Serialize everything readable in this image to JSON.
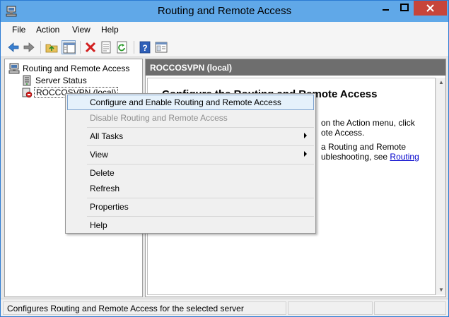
{
  "window": {
    "title": "Routing and Remote Access"
  },
  "menubar": {
    "items": [
      "File",
      "Action",
      "View",
      "Help"
    ]
  },
  "toolbar": {
    "icons": [
      "back-arrow-icon",
      "forward-arrow-icon",
      "up-folder-icon",
      "show-hide-tree-icon",
      "delete-icon",
      "properties-icon",
      "refresh-icon",
      "help-icon",
      "console-view-icon"
    ]
  },
  "tree": {
    "root": "Routing and Remote Access",
    "items": [
      "Server Status",
      "ROCCOSVPN (local)"
    ]
  },
  "rightpane": {
    "header": "ROCCOSVPN (local)",
    "heading": "Configure the Routing and Remote Access",
    "lines": [
      "on the Action menu, click",
      "ote Access.",
      "a Routing and Remote",
      "ubleshooting, see "
    ],
    "link": "Routing"
  },
  "contextmenu": {
    "configure": "Configure and Enable Routing and Remote Access",
    "disable": "Disable Routing and Remote Access",
    "all_tasks": "All Tasks",
    "view": "View",
    "delete": "Delete",
    "refresh": "Refresh",
    "properties": "Properties",
    "help": "Help"
  },
  "statusbar": {
    "text": "Configures Routing and Remote Access for the selected server"
  },
  "colors": {
    "titlebar": "#60a8e8",
    "close": "#c7453a",
    "pane_header": "#6e6e6e",
    "menu_highlight": "#e5f1fb",
    "link": "#0000cc"
  }
}
